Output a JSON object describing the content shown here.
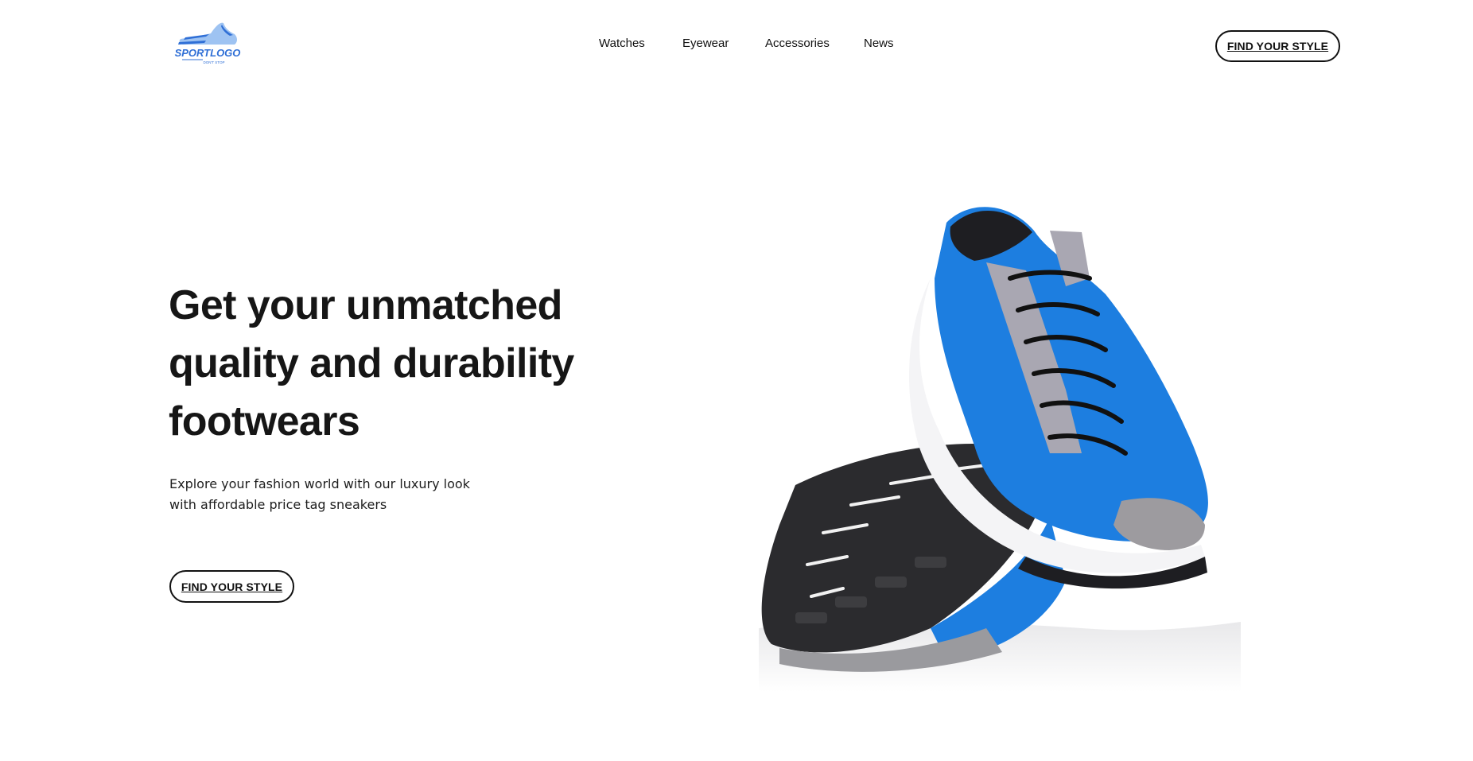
{
  "brand": {
    "logo_text": "SPORTLOGO",
    "logo_tagline": "DON'T STOP",
    "logo_color": "#2f6fd6"
  },
  "nav": {
    "items": [
      {
        "label": "Watches"
      },
      {
        "label": "Eyewear"
      },
      {
        "label": "Accessories"
      },
      {
        "label": "News"
      }
    ]
  },
  "header": {
    "cta_label": "FIND YOUR STYLE"
  },
  "hero": {
    "headline_lines": [
      "Get your unmatched",
      "quality and durability",
      "footwears"
    ],
    "subtext_lines": [
      "Explore your fashion world with our luxury look",
      "with affordable price tag sneakers"
    ],
    "cta_label": "FIND YOUR STYLE",
    "image_icon": "blue-sneakers-image",
    "accent_color": "#1d7ee0"
  }
}
